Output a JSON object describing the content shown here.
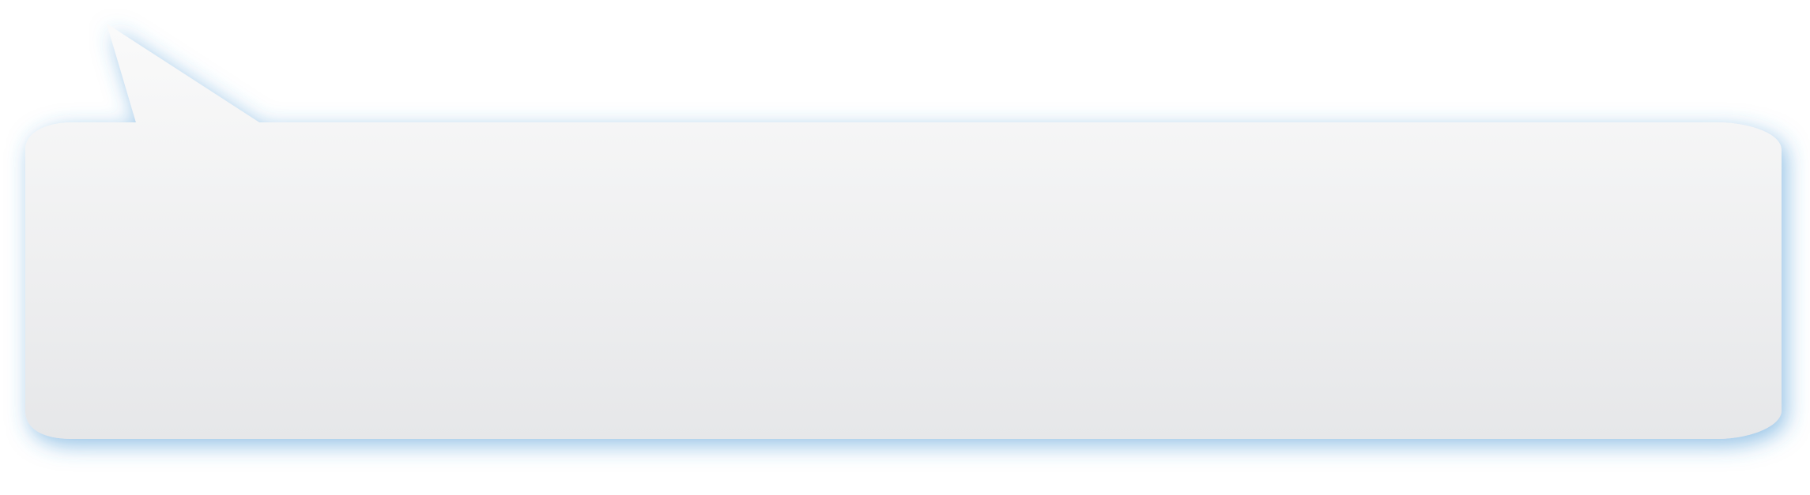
{
  "callout": {
    "text": "",
    "colors": {
      "fill_top": "#fafafa",
      "fill_bottom": "#e6e7e9",
      "glow": "#3a8fd0"
    }
  }
}
